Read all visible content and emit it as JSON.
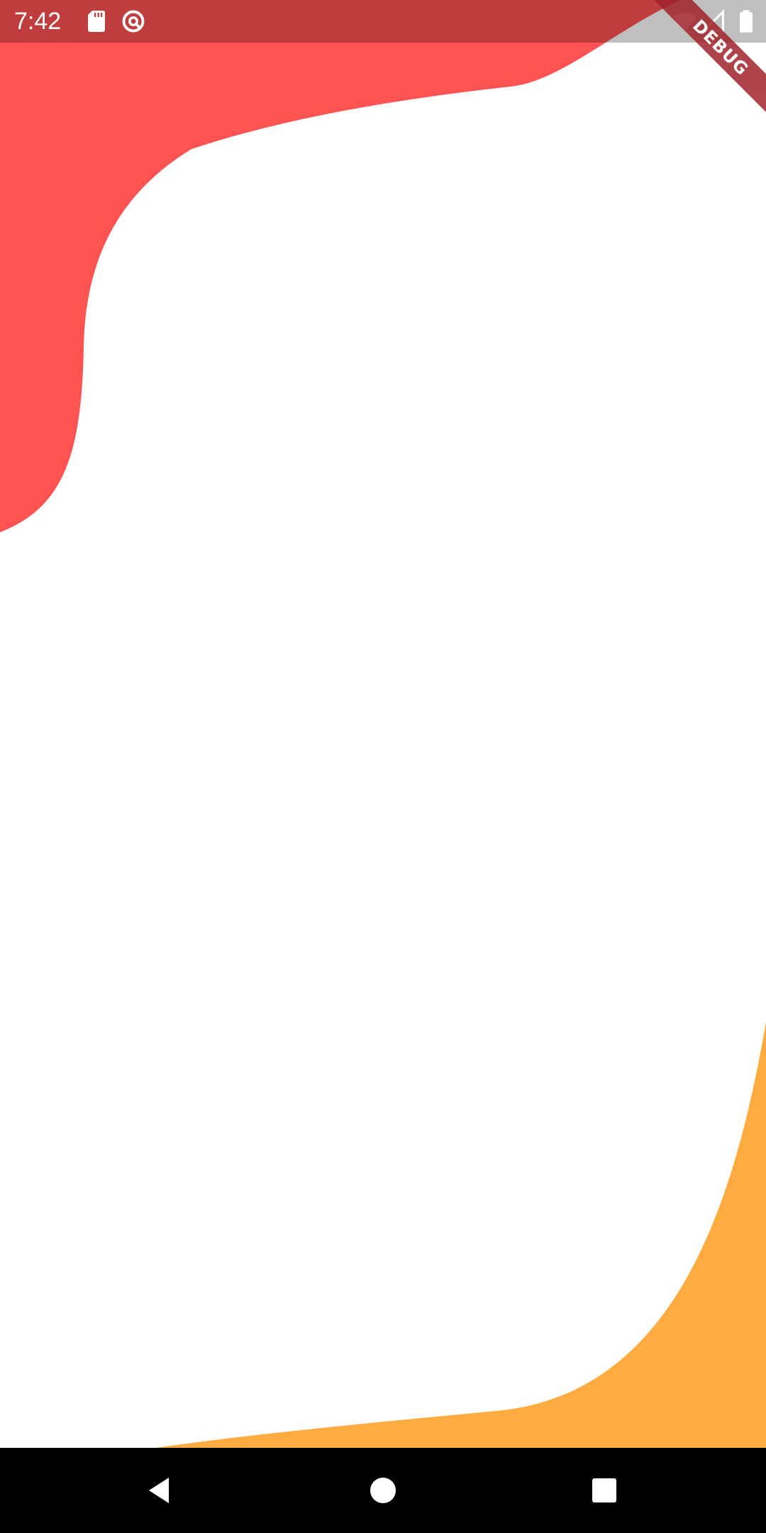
{
  "status_bar": {
    "time": "7:42",
    "left_icons": [
      "sd-card-icon",
      "data-saver-icon"
    ],
    "right_icons": [
      "wifi-icon",
      "cell-signal-icon",
      "battery-icon"
    ]
  },
  "debug_banner": {
    "label": "DEBUG",
    "color": "#a1232c"
  },
  "colors": {
    "background": "#ffffff",
    "top_blob": "#ff5252",
    "bottom_blob": "#ffab40",
    "nav_bar": "#000000"
  },
  "nav_bar": {
    "buttons": [
      {
        "name": "back",
        "icon": "back-triangle-icon"
      },
      {
        "name": "home",
        "icon": "home-circle-icon"
      },
      {
        "name": "recents",
        "icon": "recents-square-icon"
      }
    ]
  }
}
